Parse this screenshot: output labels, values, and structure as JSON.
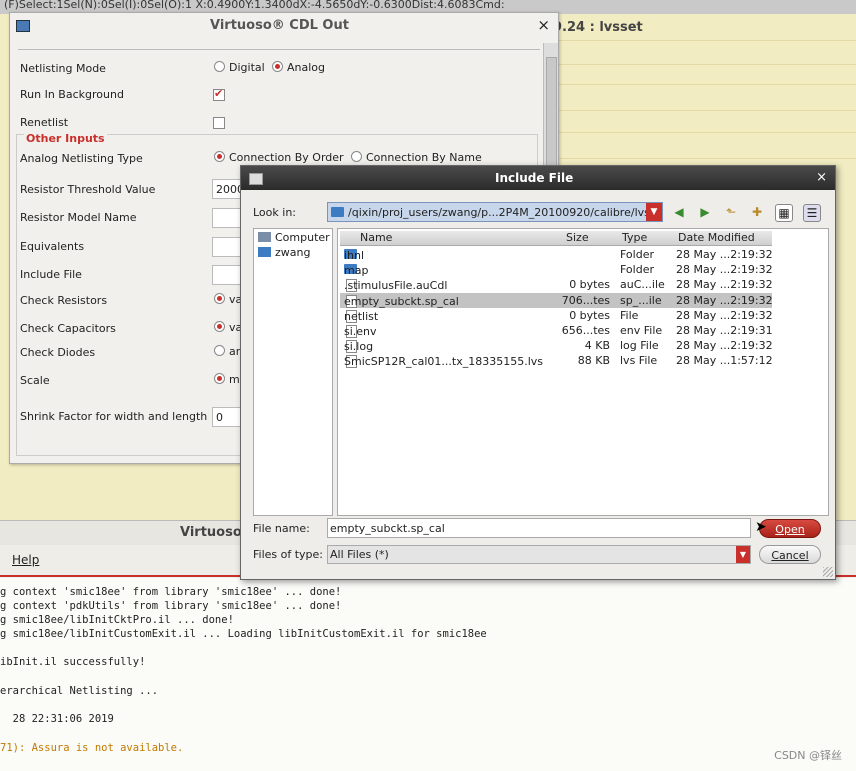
{
  "background": {
    "status_line": "(F)Select:1Sel(N):0Sel(I):0Sel(O):1  X:0.4900Y:1.3400dX:-4.5650dY:-0.6300Dist:4.6083Cmd:",
    "lvs_title": "9.24 : lvsset",
    "bottom_window_title": "Virtuoso",
    "menu_help": "Help",
    "console_lines": [
      "g context 'smic18ee' from library 'smic18ee' ... done!",
      "g context 'pdkUtils' from library 'smic18ee' ... done!",
      "g smic18ee/libInitCktPro.il ... done!",
      "g smic18ee/libInitCustomExit.il ... Loading libInitCustomExit.il for smic18ee",
      "",
      "ibInit.il successfully!",
      "",
      "erarchical Netlisting ...",
      "",
      "  28 22:31:06 2019",
      "",
      "71): Assura is not available."
    ],
    "watermark": "CSDN @铎丝"
  },
  "cdl_dialog": {
    "title": "Virtuoso® CDL Out",
    "netlisting_mode_label": "Netlisting Mode",
    "mode_digital": "Digital",
    "mode_analog": "Analog",
    "run_in_background_label": "Run In Background",
    "renetlist_label": "Renetlist",
    "other_inputs_legend": "Other Inputs",
    "analog_netlisting_type_label": "Analog Netlisting Type",
    "connection_by_order": "Connection By Order",
    "connection_by_name": "Connection By Name",
    "resistor_threshold_label": "Resistor Threshold Value",
    "resistor_threshold_value": "2000",
    "resistor_model_label": "Resistor Model Name",
    "equivalents_label": "Equivalents",
    "include_file_label": "Include File",
    "check_resistors_label": "Check Resistors",
    "check_resistors_opt": "va",
    "check_capacitors_label": "Check Capacitors",
    "check_capacitors_opt": "va",
    "check_diodes_label": "Check Diodes",
    "check_diodes_opt": "ar",
    "scale_label": "Scale",
    "scale_opt": "m",
    "shrink_factor_label": "Shrink Factor for width and length",
    "shrink_factor_value": "0"
  },
  "include_dialog": {
    "title": "Include File",
    "look_in_label": "Look in:",
    "look_in_path": "/qixin/proj_users/zwang/p...2P4M_20100920/calibre/lvs",
    "places": [
      "Computer",
      "zwang"
    ],
    "columns": [
      "Name",
      "Size",
      "Type",
      "Date Modified"
    ],
    "files": [
      {
        "name": "ihnl",
        "size": "",
        "type": "Folder",
        "date": "28 May ...2:19:32",
        "kind": "folder"
      },
      {
        "name": "map",
        "size": "",
        "type": "Folder",
        "date": "28 May ...2:19:32",
        "kind": "folder"
      },
      {
        "name": ".stimulusFile.auCdl",
        "size": "0 bytes",
        "type": "auC...ile",
        "date": "28 May ...2:19:32",
        "kind": "doc"
      },
      {
        "name": "empty_subckt.sp_cal",
        "size": "706...tes",
        "type": "sp_...ile",
        "date": "28 May ...2:19:32",
        "kind": "doc"
      },
      {
        "name": "netlist",
        "size": "0 bytes",
        "type": "File",
        "date": "28 May ...2:19:32",
        "kind": "doc"
      },
      {
        "name": "si.env",
        "size": "656...tes",
        "type": "env File",
        "date": "28 May ...2:19:31",
        "kind": "doc"
      },
      {
        "name": "si.log",
        "size": "4 KB",
        "type": "log File",
        "date": "28 May ...2:19:32",
        "kind": "doc"
      },
      {
        "name": "SmicSP12R_cal01...tx_18335155.lvs",
        "size": "88 KB",
        "type": "lvs File",
        "date": "28 May ...1:57:12",
        "kind": "doc"
      }
    ],
    "selected_index": 3,
    "file_name_label": "File name:",
    "file_name_value": "empty_subckt.sp_cal",
    "files_of_type_label": "Files of type:",
    "files_of_type_value": "All Files (*)",
    "open_label": "Open",
    "cancel_label": "Cancel"
  }
}
